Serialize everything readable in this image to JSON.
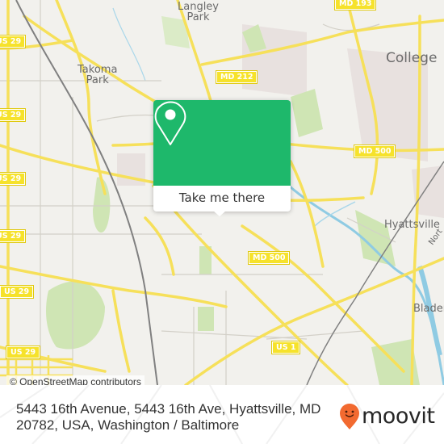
{
  "map": {
    "place_labels": [
      {
        "id": "langley-park",
        "text_line1": "Langley",
        "text_line2": "Park"
      },
      {
        "id": "takoma-park",
        "text_line1": "Takoma",
        "text_line2": "Park"
      },
      {
        "id": "college",
        "text_line1": "College",
        "text_line2": ""
      },
      {
        "id": "hyattsville",
        "text_line1": "Hyattsville",
        "text_line2": ""
      },
      {
        "id": "bladensburg",
        "text_line1": "Bladen",
        "text_line2": ""
      },
      {
        "id": "northeast",
        "text_line1": "Nort",
        "text_line2": ""
      }
    ],
    "road_shields": [
      {
        "id": "md-193",
        "text": "MD 193"
      },
      {
        "id": "md-212",
        "text": "MD 212"
      },
      {
        "id": "md-500-east",
        "text": "MD 500"
      },
      {
        "id": "md-500-south",
        "text": "MD 500"
      },
      {
        "id": "us-1",
        "text": "US 1"
      },
      {
        "id": "us-29-a",
        "text": "US 29"
      },
      {
        "id": "us-29-b",
        "text": "US 29"
      },
      {
        "id": "us-29-c",
        "text": "US 29"
      },
      {
        "id": "us-29-d",
        "text": "US 29"
      },
      {
        "id": "us-29-e",
        "text": "US 29"
      },
      {
        "id": "us-29-f",
        "text": "US 29"
      },
      {
        "id": "us-29-g",
        "text": "US 29"
      }
    ],
    "attribution": "© OpenStreetMap contributors",
    "colors": {
      "background": "#f2f1ed",
      "road_major": "#f6e05a",
      "road_minor": "#d3d0c8",
      "park": "#cfe5b4",
      "water": "#8fcbe3",
      "rail": "#777777",
      "urban": "#e8e1df"
    }
  },
  "popup": {
    "icon": "map-pin-icon",
    "button_label": "Take me there",
    "accent_color": "#1eb86b"
  },
  "footer": {
    "address_line1": "5443 16th Avenue, 5443 16th Ave, Hyattsville, MD",
    "address_line2": "20782, USA, Washington / Baltimore",
    "logo_text": "moovit",
    "logo_icon": "moovit-pin-face-icon",
    "logo_color": "#f26a30"
  }
}
